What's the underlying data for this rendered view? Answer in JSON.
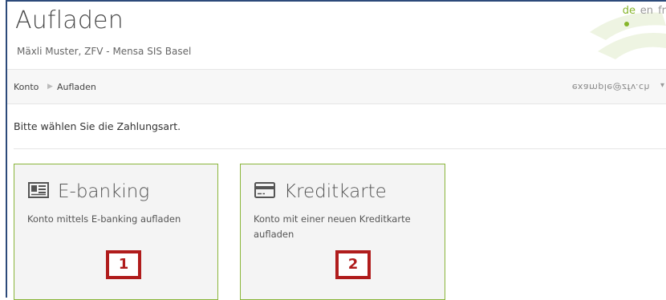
{
  "header": {
    "title": "Aufladen",
    "subtitle": "Mäxli Muster, ZFV - Mensa SIS Basel",
    "languages": [
      {
        "code": "de",
        "active": true
      },
      {
        "code": "en",
        "active": false
      },
      {
        "code": "fr",
        "active": false
      }
    ],
    "accent_color": "#86b52a"
  },
  "breadcrumb": {
    "items": [
      "Konto",
      "Aufladen"
    ],
    "user_email": "example@zfv.ch"
  },
  "main": {
    "instruction": "Bitte wählen Sie die Zahlungsart.",
    "payment_options": [
      {
        "icon": "newspaper-icon",
        "title": "E-banking",
        "description": "Konto mittels E-banking aufladen",
        "step": "1"
      },
      {
        "icon": "credit-card-icon",
        "title": "Kreditkarte",
        "description": "Konto mit einer neuen Kreditkarte aufladen",
        "step": "2"
      }
    ]
  },
  "colors": {
    "card_border": "#8ab53a",
    "step_badge": "#b01c1c",
    "frame": "#2c4a7a"
  }
}
